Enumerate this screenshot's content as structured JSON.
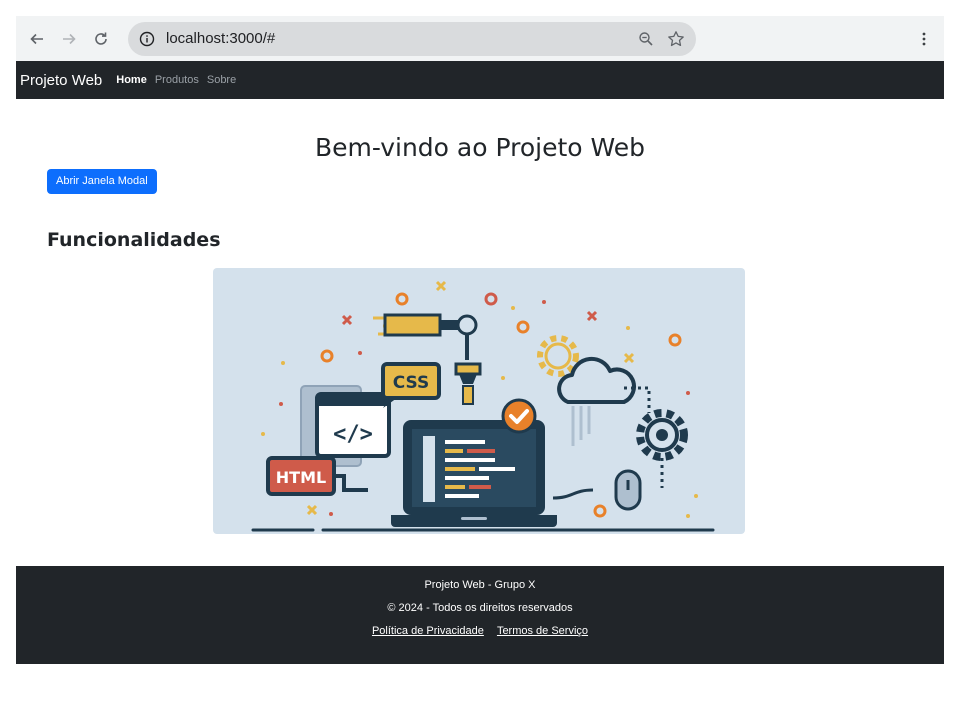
{
  "browser": {
    "url": "localhost:3000/#",
    "icons": [
      "back-arrow-icon",
      "forward-arrow-icon",
      "reload-icon",
      "site-info-icon",
      "zoom-icon",
      "bookmark-star-icon",
      "kebab-menu-icon"
    ]
  },
  "navbar": {
    "brand": "Projeto Web",
    "links": [
      {
        "label": "Home",
        "active": true
      },
      {
        "label": "Produtos",
        "active": false
      },
      {
        "label": "Sobre",
        "active": false
      }
    ]
  },
  "main": {
    "title": "Bem-vindo ao Projeto Web",
    "modal_button": "Abrir Janela Modal",
    "features_title": "Funcionalidades",
    "illustration": {
      "css_badge": "CSS",
      "html_badge": "HTML",
      "code_symbol": "</>"
    }
  },
  "footer": {
    "line1": "Projeto Web - Grupo X",
    "line2": "© 2024 - Todos os direitos reservados",
    "links": [
      "Política de Privacidade",
      "Termos de Serviço"
    ]
  },
  "colors": {
    "navbar_bg": "#212529",
    "primary_button": "#0d6efd",
    "illustration_bg": "#d4e1ec",
    "accent_orange": "#e8812a",
    "accent_red": "#cf5b4a",
    "accent_yellow": "#e6b94a",
    "dark_navy": "#1f3a4d"
  }
}
